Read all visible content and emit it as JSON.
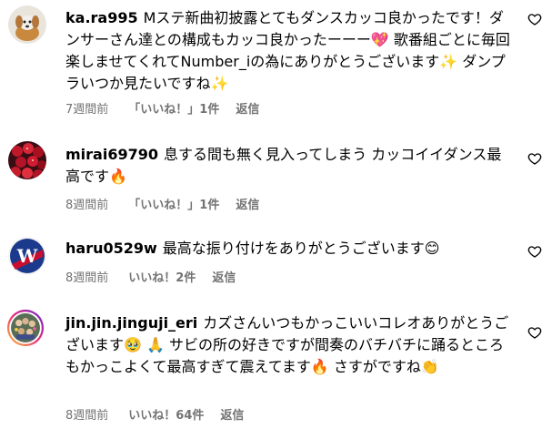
{
  "comments": [
    {
      "username": "ka.ra995",
      "text": "Mステ新曲初披露とてもダンスカッコ良かったです！ダンサーさん達との構成もカッコ良かったーーー💖 歌番組ごとに毎回楽しませてくれてNumber_iの為にありがとうございます✨ ダンプラいつか見たいですね✨",
      "time": "7週間前",
      "likes": "「いいね！」1件",
      "reply": "返信"
    },
    {
      "username": "mirai69790",
      "text": "息する間も無く見入ってしまう カッコイイダンス最高です🔥",
      "time": "8週間前",
      "likes": "「いいね！」1件",
      "reply": "返信"
    },
    {
      "username": "haru0529w",
      "text": "最高な振り付けをありがとうございます😊",
      "time": "8週間前",
      "likes": "いいね！2件",
      "reply": "返信"
    },
    {
      "username": "jin.jin.jinguji_eri",
      "text": "カズさんいつもかっこいいコレオありがとうございます🥹 🙏 サビの所の好きですが間奏のバチバチに踊るところもかっこよくて最高すぎて震えてます🔥 さすがですね👏",
      "time": "8週間前",
      "likes": "いいね！64件",
      "reply": "返信"
    }
  ],
  "icons": {
    "like": "heart-outline-icon"
  },
  "colors": {
    "meta_text": "#737373",
    "story_ring_start": "#f9ce34",
    "story_ring_end": "#ee2a7b"
  }
}
